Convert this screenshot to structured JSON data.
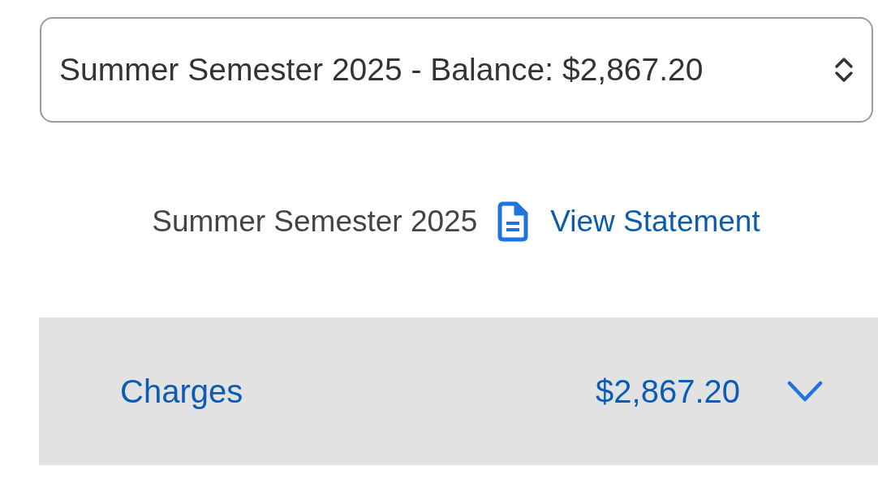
{
  "term_select": {
    "value": "Summer Semester 2025 - Balance: $2,867.20"
  },
  "statement": {
    "term": "Summer Semester 2025",
    "link": "View Statement"
  },
  "sections": [
    {
      "label": "Charges",
      "amount": "$2,867.20",
      "expanded": false
    }
  ]
}
